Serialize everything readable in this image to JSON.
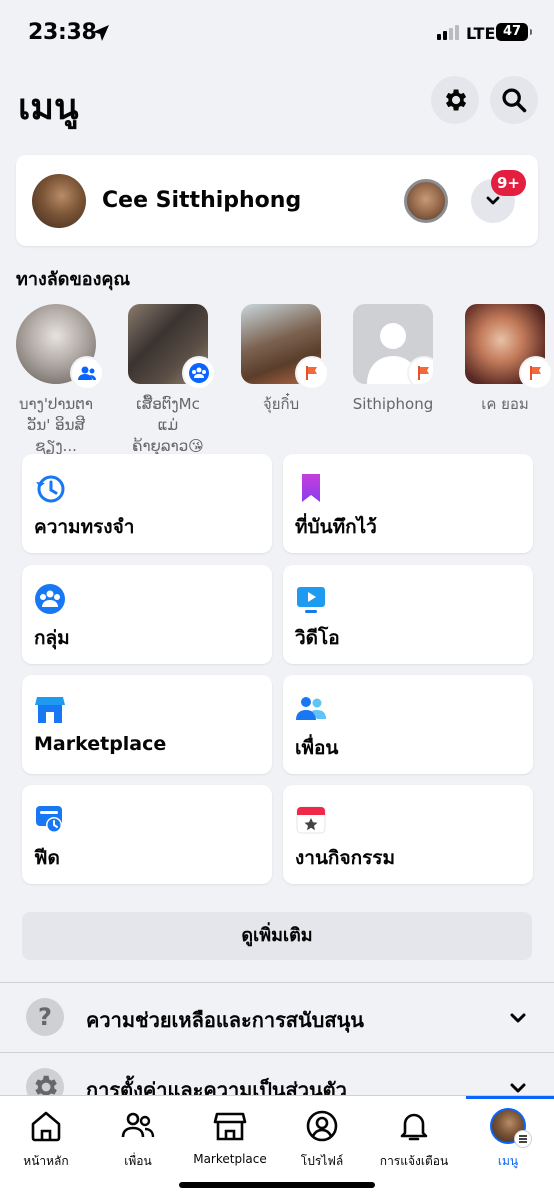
{
  "status": {
    "time": "23:38",
    "network": "LTE",
    "battery": "47",
    "battery_level": 0.47
  },
  "header": {
    "title": "เมนู",
    "settings_icon": "gear-icon",
    "search_icon": "search-icon"
  },
  "profile": {
    "name": "Cee Sitthiphong",
    "badge": "9+"
  },
  "shortcuts": {
    "label": "ทางลัดของคุณ",
    "items": [
      {
        "line1": "บາງ'ປານຕາ",
        "line2": "ວັນ' ອິນສີຊຽງ...",
        "badge": "group-icon"
      },
      {
        "line1": "ເສື້ອຕົງMc ແມ່",
        "line2": "ຄ້າຍຸລາວ😘",
        "badge": "group-icon"
      },
      {
        "line1": "จุ้ยกิ๋บ",
        "line2": "",
        "badge": "flag-icon"
      },
      {
        "line1": "Sithiphong",
        "line2": "",
        "badge": "flag-icon"
      },
      {
        "line1": "เค ยอม",
        "line2": "",
        "badge": "flag-icon"
      }
    ]
  },
  "tiles": {
    "memories": "ความทรงจำ",
    "saved": "ที่บันทึกไว้",
    "groups": "กลุ่ม",
    "video": "วิดีโอ",
    "marketplace": "Marketplace",
    "friends": "เพื่อน",
    "feeds": "ฟีด",
    "events": "งานกิจกรรม"
  },
  "see_more": "ดูเพิ่มเติม",
  "accordion": {
    "help": "ความช่วยเหลือและการสนับสนุน",
    "settings": "การตั้งค่าและความเป็นส่วนตัว"
  },
  "nav": {
    "home": "หน้าหลัก",
    "friends": "เพื่อน",
    "marketplace": "Marketplace",
    "profile": "โปรไฟล์",
    "notifications": "การแจ้งเตือน",
    "menu": "เมนู"
  },
  "colors": {
    "accent": "#0866FF",
    "badge": "#E41E3F",
    "background": "#F0F2F5"
  }
}
